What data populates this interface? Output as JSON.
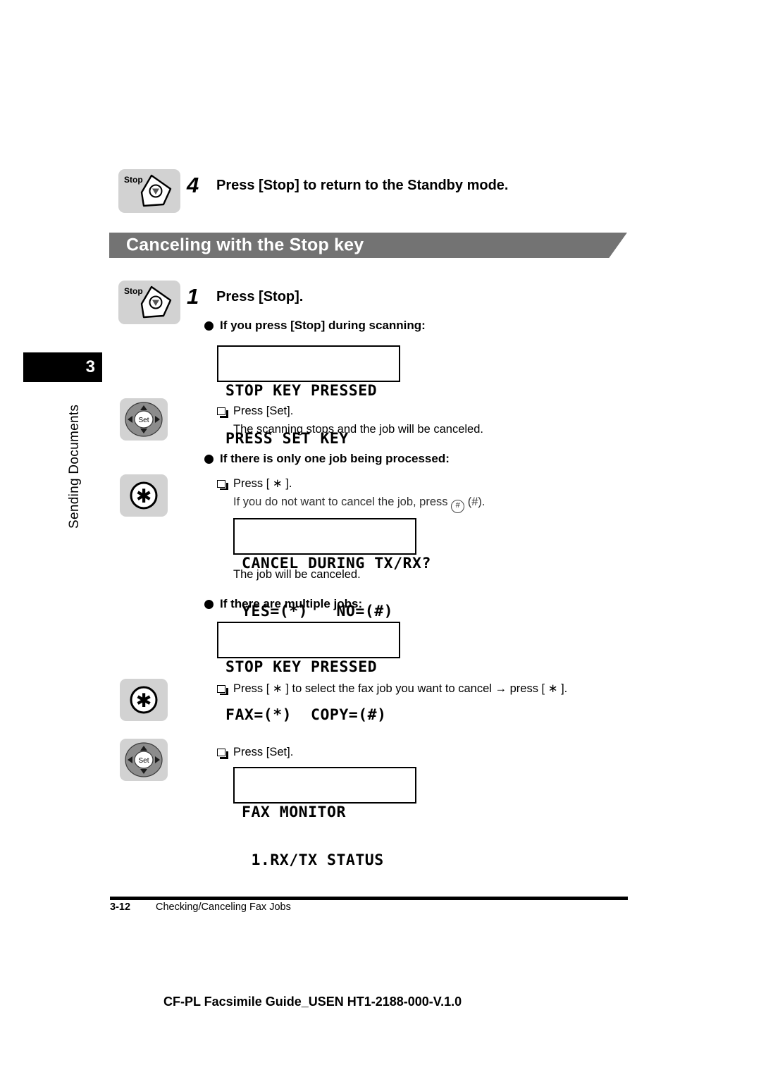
{
  "chapter": {
    "number": "3",
    "label": "Sending Documents"
  },
  "steps": [
    {
      "num": "4",
      "title": "Press [Stop] to return to the Standby mode.",
      "key_icon": "stop-key-icon",
      "key_label": "Stop"
    },
    {
      "num": "1",
      "title": "Press [Stop].",
      "key_icon": "stop-key-icon",
      "key_label": "Stop"
    }
  ],
  "banner": {
    "title": "Canceling with the Stop key"
  },
  "sections": [
    {
      "heading": "If you press [Stop] during scanning:",
      "lcd": {
        "line1": "STOP KEY PRESSED",
        "line2": "PRESS SET KEY"
      },
      "action": "Press [Set].",
      "note": "The scanning stops and the job will be canceled.",
      "key_label": "Set"
    },
    {
      "heading": "If there is only one job being processed:",
      "action": "Press [ ∗ ].",
      "note_pre": "If you do not want to cancel the job, press",
      "note_circle": "#",
      "note_post": "(#).",
      "lcd": {
        "line1": "CANCEL DURING TX/RX?",
        "line2": "YES=(*)   NO=(#)"
      },
      "result": "The job will be canceled."
    },
    {
      "heading": "If there are multiple jobs:",
      "lcd": {
        "line1": "STOP KEY PRESSED",
        "line2": "FAX=(*)  COPY=(#)"
      },
      "action": "Press [ ∗ ] to select the fax job you want to cancel → press [ ∗ ].",
      "action2": "Press [Set].",
      "lcd2": {
        "line1": "FAX MONITOR",
        "line2": " 1.RX/TX STATUS"
      }
    }
  ],
  "footer": {
    "page_number": "3-12",
    "section_title": "Checking/Canceling Fax Jobs",
    "doc_id": "CF-PL Facsimile Guide_USEN HT1-2188-000-V.1.0"
  },
  "colors": {
    "banner_gray": "#737373",
    "key_gray": "#d2d2d2",
    "tab_black": "#000000"
  }
}
